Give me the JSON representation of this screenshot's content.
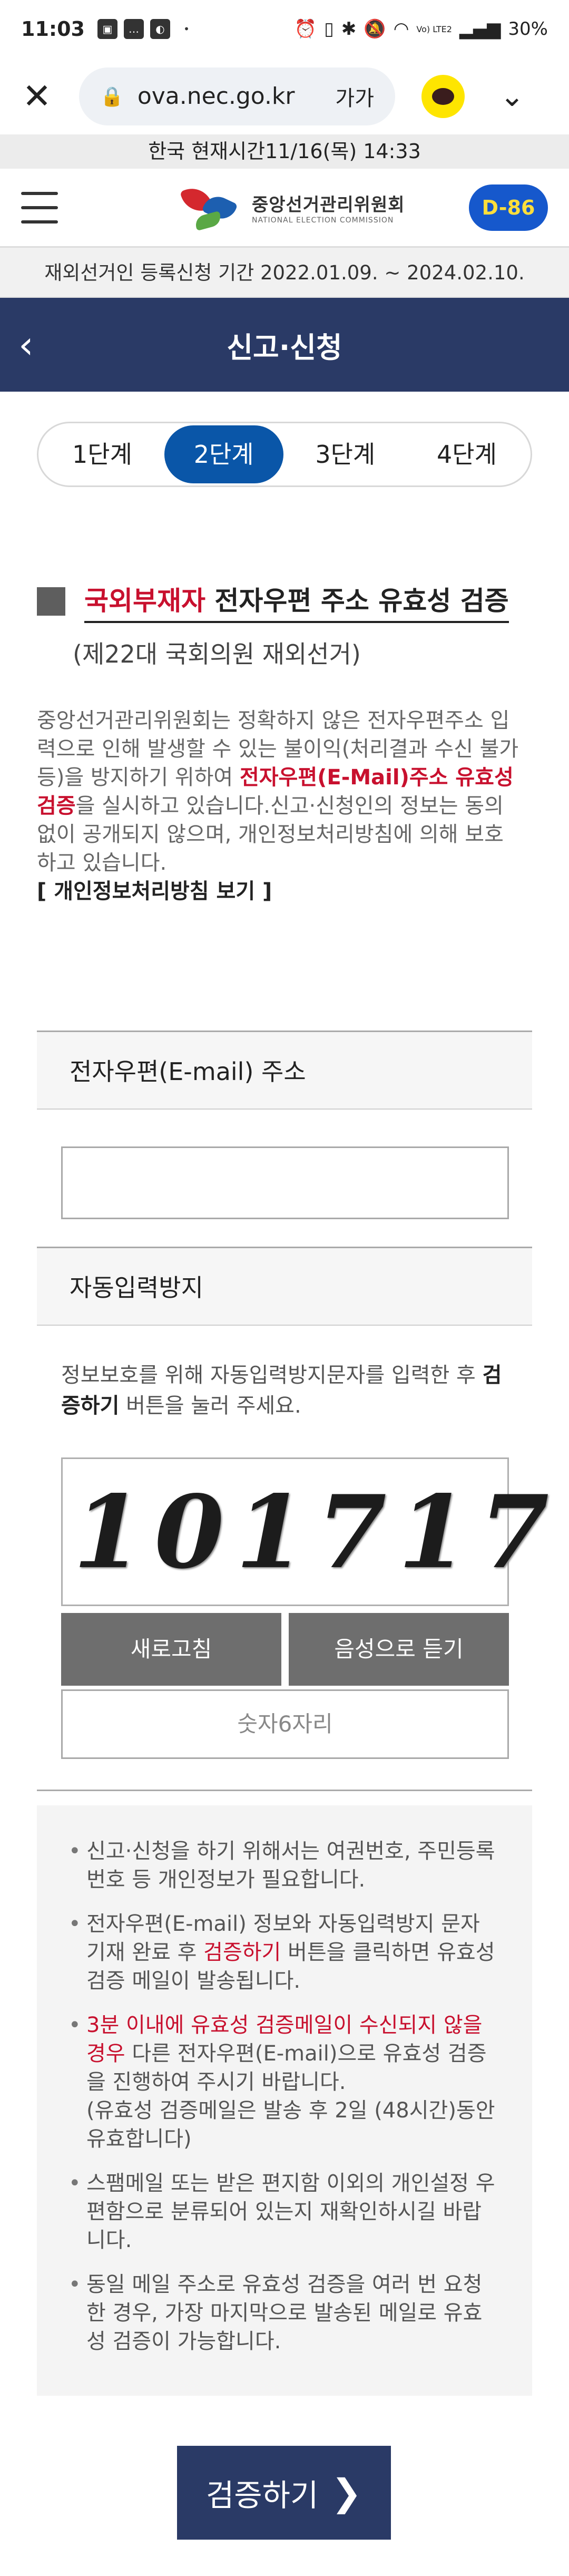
{
  "status_bar": {
    "time": "11:03",
    "battery": "30%",
    "network": "Vo) LTE2"
  },
  "browser": {
    "url": "ova.nec.go.kr",
    "text_size_label": "가가"
  },
  "time_banner": "한국 현재시간11/16(목) 14:33",
  "header": {
    "logo_ko": "중앙선거관리위원회",
    "logo_en": "NATIONAL ELECTION COMMISSION",
    "dday": "D-86"
  },
  "period_banner": "재외선거인 등록신청 기간 2022.01.09. ~ 2024.02.10.",
  "page_title": "신고·신청",
  "steps": [
    {
      "label": "1단계"
    },
    {
      "label": "2단계"
    },
    {
      "label": "3단계"
    },
    {
      "label": "4단계"
    }
  ],
  "section": {
    "heading_red": "국외부재자",
    "heading_rest": " 전자우편 주소 유효성 검증",
    "subtitle": "(제22대 국회의원 재외선거)"
  },
  "intro": {
    "part1": "중앙선거관리위원회는 정확하지 않은 전자우편주소 입력으로 인해 발생할 수 있는 불이익(처리결과 수신 불가 등)을 방지하기 위하여 ",
    "highlight": "전자우편(E-Mail)주소 유효성 검증",
    "part2": "을 실시하고 있습니다.신고·신청인의 정보는 동의 없이 공개되지 않으며, 개인정보처리방침에 의해 보호하고 있습니다.",
    "privacy_link": "[ 개인정보처리방침 보기 ]"
  },
  "email_field": {
    "label": "전자우편(E-mail) 주소",
    "value": ""
  },
  "captcha": {
    "label": "자동입력방지",
    "help_part1": "정보보호를 위해 자동입력방지문자를 입력한 후 ",
    "help_bold": "검증하기",
    "help_part2": " 버튼을 눌러 주세요.",
    "image_text": "101717",
    "refresh_label": "새로고침",
    "audio_label": "음성으로 듣기",
    "input_placeholder": "숫자6자리"
  },
  "notices": {
    "n1": "신고·신청을 하기 위해서는 여권번호, 주민등록번호 등 개인정보가 필요합니다.",
    "n2_a": "전자우편(E-mail) 정보와 자동입력방지 문자 기재 완료 후 ",
    "n2_red": "검증하기",
    "n2_b": " 버튼을 클릭하면 유효성 검증 메일이 발송됩니다.",
    "n3_red": "3분 이내에 유효성 검증메일이 수신되지 않을 경우",
    "n3_b": " 다른 전자우편(E-mail)으로 유효성 검증을 진행하여 주시기 바랍니다.",
    "n3_c": "(유효성 검증메일은 발송 후 2일 (48시간)동안 유효합니다)",
    "n4": "스팸메일 또는 받은 편지함 이외의 개인설정 우편함으로 분류되어 있는지 재확인하시길 바랍니다.",
    "n5": "동일 메일 주소로 유효성 검증을 여러 번 요청한 경우, 가장 마지막으로 발송된 메일로 유효성 검증이 가능합니다."
  },
  "verify_button": "검증하기",
  "colors": {
    "navy": "#2a3a66",
    "step_active": "#0a56a8",
    "highlight_red": "#c8102e",
    "dday_bg": "#1658cc"
  }
}
